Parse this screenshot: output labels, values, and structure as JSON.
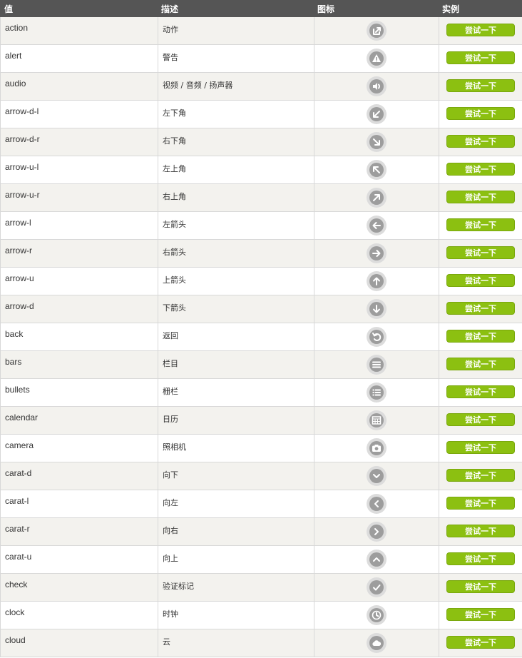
{
  "header": {
    "col_value": "值",
    "col_desc": "描述",
    "col_icon": "图标",
    "col_example": "实例"
  },
  "colors": {
    "button": "#8cc011",
    "header_bg": "#555555",
    "icon_bg": "#9d9d9d"
  },
  "rows": [
    {
      "value": "action",
      "desc": "动作",
      "icon": "action-icon",
      "button": "尝试一下"
    },
    {
      "value": "alert",
      "desc": "警告",
      "icon": "alert-icon",
      "button": "尝试一下"
    },
    {
      "value": "audio",
      "desc": "视频 / 音频 / 扬声器",
      "icon": "audio-icon",
      "button": "尝试一下"
    },
    {
      "value": "arrow-d-l",
      "desc": "左下角",
      "icon": "arrow-d-l-icon",
      "button": "尝试一下"
    },
    {
      "value": "arrow-d-r",
      "desc": "右下角",
      "icon": "arrow-d-r-icon",
      "button": "尝试一下"
    },
    {
      "value": "arrow-u-l",
      "desc": "左上角",
      "icon": "arrow-u-l-icon",
      "button": "尝试一下"
    },
    {
      "value": "arrow-u-r",
      "desc": "右上角",
      "icon": "arrow-u-r-icon",
      "button": "尝试一下"
    },
    {
      "value": "arrow-l",
      "desc": "左箭头",
      "icon": "arrow-l-icon",
      "button": "尝试一下"
    },
    {
      "value": "arrow-r",
      "desc": "右箭头",
      "icon": "arrow-r-icon",
      "button": "尝试一下"
    },
    {
      "value": "arrow-u",
      "desc": "上箭头",
      "icon": "arrow-u-icon",
      "button": "尝试一下"
    },
    {
      "value": "arrow-d",
      "desc": "下箭头",
      "icon": "arrow-d-icon",
      "button": "尝试一下"
    },
    {
      "value": "back",
      "desc": "返回",
      "icon": "back-icon",
      "button": "尝试一下"
    },
    {
      "value": "bars",
      "desc": "栏目",
      "icon": "bars-icon",
      "button": "尝试一下"
    },
    {
      "value": "bullets",
      "desc": "栅栏",
      "icon": "bullets-icon",
      "button": "尝试一下"
    },
    {
      "value": "calendar",
      "desc": "日历",
      "icon": "calendar-icon",
      "button": "尝试一下"
    },
    {
      "value": "camera",
      "desc": "照相机",
      "icon": "camera-icon",
      "button": "尝试一下"
    },
    {
      "value": "carat-d",
      "desc": "向下",
      "icon": "carat-d-icon",
      "button": "尝试一下"
    },
    {
      "value": "carat-l",
      "desc": "向左",
      "icon": "carat-l-icon",
      "button": "尝试一下"
    },
    {
      "value": "carat-r",
      "desc": "向右",
      "icon": "carat-r-icon",
      "button": "尝试一下"
    },
    {
      "value": "carat-u",
      "desc": "向上",
      "icon": "carat-u-icon",
      "button": "尝试一下"
    },
    {
      "value": "check",
      "desc": "验证标记",
      "icon": "check-icon",
      "button": "尝试一下"
    },
    {
      "value": "clock",
      "desc": "时钟",
      "icon": "clock-icon",
      "button": "尝试一下"
    },
    {
      "value": "cloud",
      "desc": "云",
      "icon": "cloud-icon",
      "button": "尝试一下"
    }
  ]
}
